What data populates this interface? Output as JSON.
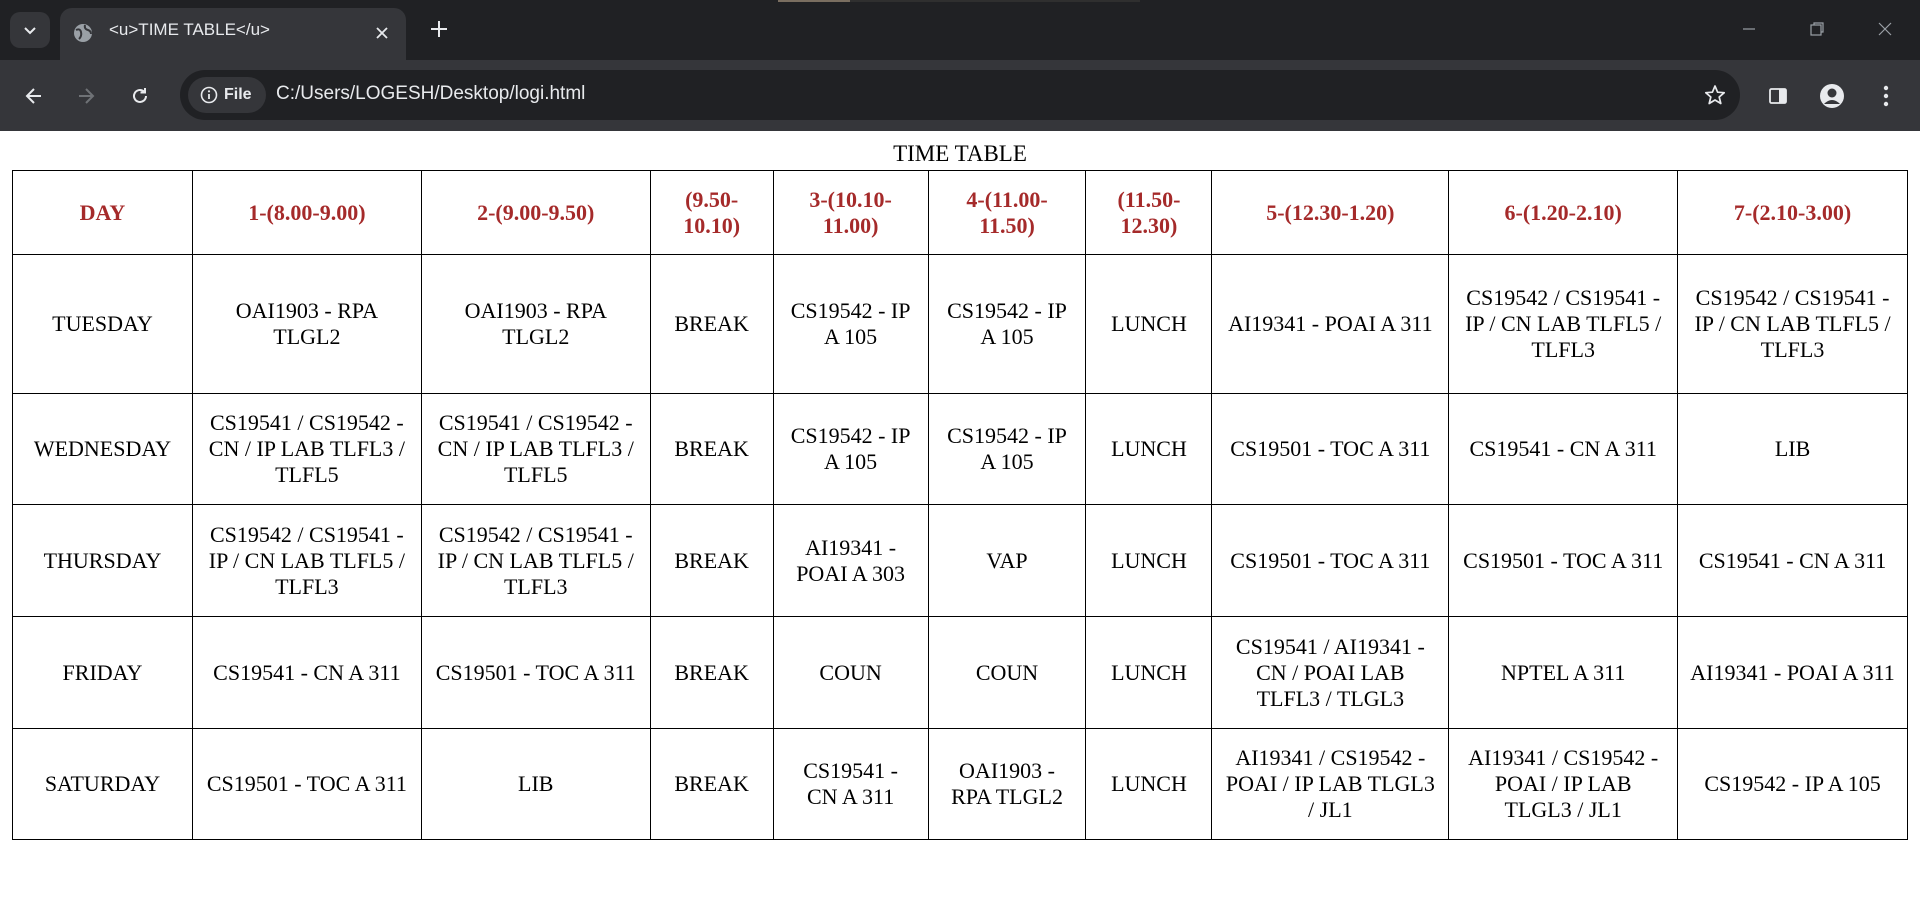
{
  "browser": {
    "tab_title": "<u>TIME TABLE</u>",
    "address_chip": "File",
    "url": "C:/Users/LOGESH/Desktop/logi.html"
  },
  "page": {
    "caption": "TIME TABLE",
    "headers": [
      "DAY",
      "1-(8.00-9.00)",
      "2-(9.00-9.50)",
      "(9.50-10.10)",
      "3-(10.10-11.00)",
      "4-(11.00-11.50)",
      "(11.50-12.30)",
      "5-(12.30-1.20)",
      "6-(1.20-2.10)",
      "7-(2.10-3.00)"
    ],
    "header_color": "#a52a2a",
    "rows": [
      {
        "day": "TUESDAY",
        "cells": [
          "OAI1903 - RPA TLGL2",
          "OAI1903 - RPA TLGL2",
          "BREAK",
          "CS19542 - IP A 105",
          "CS19542 - IP A 105",
          "LUNCH",
          "AI19341 - POAI A 311",
          "CS19542 / CS19541 - IP / CN LAB TLFL5 / TLFL3",
          "CS19542 / CS19541 - IP / CN LAB TLFL5 / TLFL3"
        ]
      },
      {
        "day": "WEDNESDAY",
        "cells": [
          "CS19541 / CS19542 - CN / IP LAB TLFL3 / TLFL5",
          "CS19541 / CS19542 - CN / IP LAB TLFL3 / TLFL5",
          "BREAK",
          "CS19542 - IP A 105",
          "CS19542 - IP A 105",
          "LUNCH",
          "CS19501 - TOC A 311",
          "CS19541 - CN A 311",
          "LIB"
        ]
      },
      {
        "day": "THURSDAY",
        "cells": [
          "CS19542 / CS19541 - IP / CN LAB TLFL5 / TLFL3",
          "CS19542 / CS19541 - IP / CN LAB TLFL5 / TLFL3",
          "BREAK",
          "AI19341 - POAI A 303",
          "VAP",
          "LUNCH",
          "CS19501 - TOC A 311",
          "CS19501 - TOC A 311",
          "CS19541 - CN A 311"
        ]
      },
      {
        "day": "FRIDAY",
        "cells": [
          "CS19541 - CN A 311",
          "CS19501 - TOC A 311",
          "BREAK",
          "COUN",
          "COUN",
          "LUNCH",
          "CS19541 / AI19341 - CN / POAI LAB TLFL3 / TLGL3",
          "NPTEL A 311",
          "AI19341 - POAI A 311"
        ]
      },
      {
        "day": "SATURDAY",
        "cells": [
          "CS19501 - TOC A 311",
          "LIB",
          "BREAK",
          "CS19541 - CN A 311",
          "OAI1903 - RPA TLGL2",
          "LUNCH",
          "AI19341 / CS19542 - POAI / IP LAB TLGL3 / JL1",
          "AI19341 / CS19542 - POAI / IP LAB TLGL3 / JL1",
          "CS19542 - IP A 105"
        ]
      }
    ]
  }
}
